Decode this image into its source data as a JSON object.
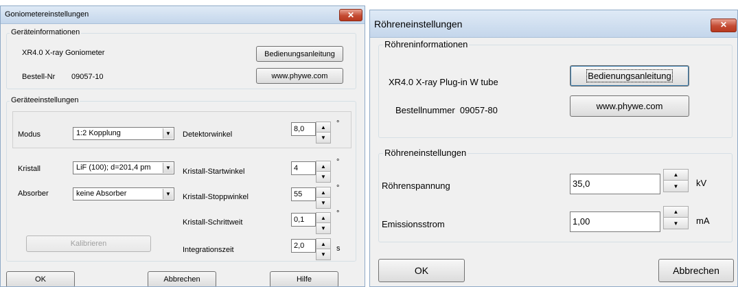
{
  "gonio": {
    "title": "Goniometereinstellungen",
    "close_glyph": "✕",
    "info": {
      "legend": "Geräteinformationen",
      "device_name": "XR4.0 X-ray Goniometer",
      "order_label": "Bestell-Nr",
      "order_value": "09057-10",
      "manual_button": "Bedienungsanleitung",
      "web_button": "www.phywe.com"
    },
    "settings": {
      "legend": "Geräteeinstellungen",
      "mode_label": "Modus",
      "mode_value": "1:2 Kopplung",
      "detector_label": "Detektorwinkel",
      "detector_value": "8,0",
      "crystal_label": "Kristall",
      "crystal_value": "LiF (100); d=201,4 pm",
      "start_label": "Kristall-Startwinkel",
      "start_value": "4",
      "absorber_label": "Absorber",
      "absorber_value": "keine Absorber",
      "stop_label": "Kristall-Stoppwinkel",
      "stop_value": "55",
      "step_label": "Kristall-Schrittweit",
      "step_value": "0,1",
      "integration_label": "Integrationszeit",
      "integration_value": "2,0",
      "calibrate_button": "Kalibrieren",
      "degree_unit": "°",
      "seconds_unit": "s"
    },
    "footer": {
      "ok": "OK",
      "cancel": "Abbrechen",
      "help": "Hilfe"
    }
  },
  "tube": {
    "title": "Röhreneinstellungen",
    "close_glyph": "✕",
    "info": {
      "legend": "Röhreninformationen",
      "device_name": "XR4.0 X-ray Plug-in W tube",
      "order_text": "Bestellnummer  09057-80",
      "manual_button": "Bedienungsanleitung",
      "web_button": "www.phywe.com"
    },
    "settings": {
      "legend": "Röhreneinstellungen",
      "voltage_label": "Röhrenspannung",
      "voltage_value": "35,0",
      "voltage_unit": "kV",
      "current_label": "Emissionsstrom",
      "current_value": "1,00",
      "current_unit": "mA"
    },
    "footer": {
      "ok": "OK",
      "cancel": "Abbrechen"
    }
  },
  "glyphs": {
    "spin_up": "▲",
    "spin_down": "▼",
    "dropdown": "▼"
  }
}
